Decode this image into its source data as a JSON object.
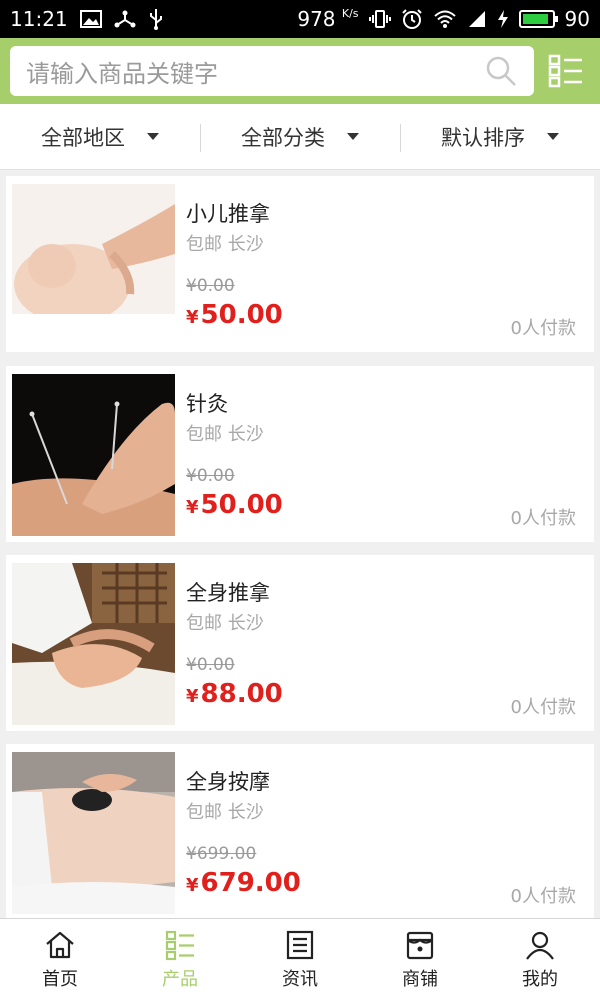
{
  "status_bar": {
    "time": "11:21",
    "speed": "978",
    "speed_unit": "K/s",
    "battery": "90",
    "battery_level": 0.9,
    "left_icons": [
      "image-icon",
      "usb-share-icon",
      "usb-icon"
    ],
    "right_icons": [
      "vibrate-icon",
      "alarm-icon",
      "wifi-icon",
      "4g-signal-icon",
      "charging-icon",
      "battery-icon"
    ]
  },
  "search": {
    "placeholder": "请输入商品关键字",
    "icon": "search-icon",
    "menu_icon": "grid-list-icon"
  },
  "filters": [
    {
      "label": "全部地区"
    },
    {
      "label": "全部分类"
    },
    {
      "label": "默认排序"
    }
  ],
  "products": [
    {
      "name": "小儿推拿",
      "shipping": "包邮",
      "city": "长沙",
      "old_price": "¥0.00",
      "currency": "¥",
      "price": "50.00",
      "sold": "0人付款",
      "image": "baby-massage-photo"
    },
    {
      "name": "针灸",
      "shipping": "包邮",
      "city": "长沙",
      "old_price": "¥0.00",
      "currency": "¥",
      "price": "50.00",
      "sold": "0人付款",
      "image": "acupuncture-photo"
    },
    {
      "name": "全身推拿",
      "shipping": "包邮",
      "city": "长沙",
      "old_price": "¥0.00",
      "currency": "¥",
      "price": "88.00",
      "sold": "0人付款",
      "image": "body-massage-photo"
    },
    {
      "name": "全身按摩",
      "shipping": "包邮",
      "city": "长沙",
      "old_price": "¥699.00",
      "currency": "¥",
      "price": "679.00",
      "sold": "0人付款",
      "image": "stone-massage-photo"
    }
  ],
  "nav": [
    {
      "label": "首页",
      "icon": "home-icon"
    },
    {
      "label": "产品",
      "icon": "product-list-icon",
      "active": true
    },
    {
      "label": "资讯",
      "icon": "news-icon"
    },
    {
      "label": "商铺",
      "icon": "shop-icon"
    },
    {
      "label": "我的",
      "icon": "user-icon"
    }
  ],
  "colors": {
    "accent": "#a6cf6b",
    "price_red": "#e0201c",
    "status_bg": "#000000"
  }
}
